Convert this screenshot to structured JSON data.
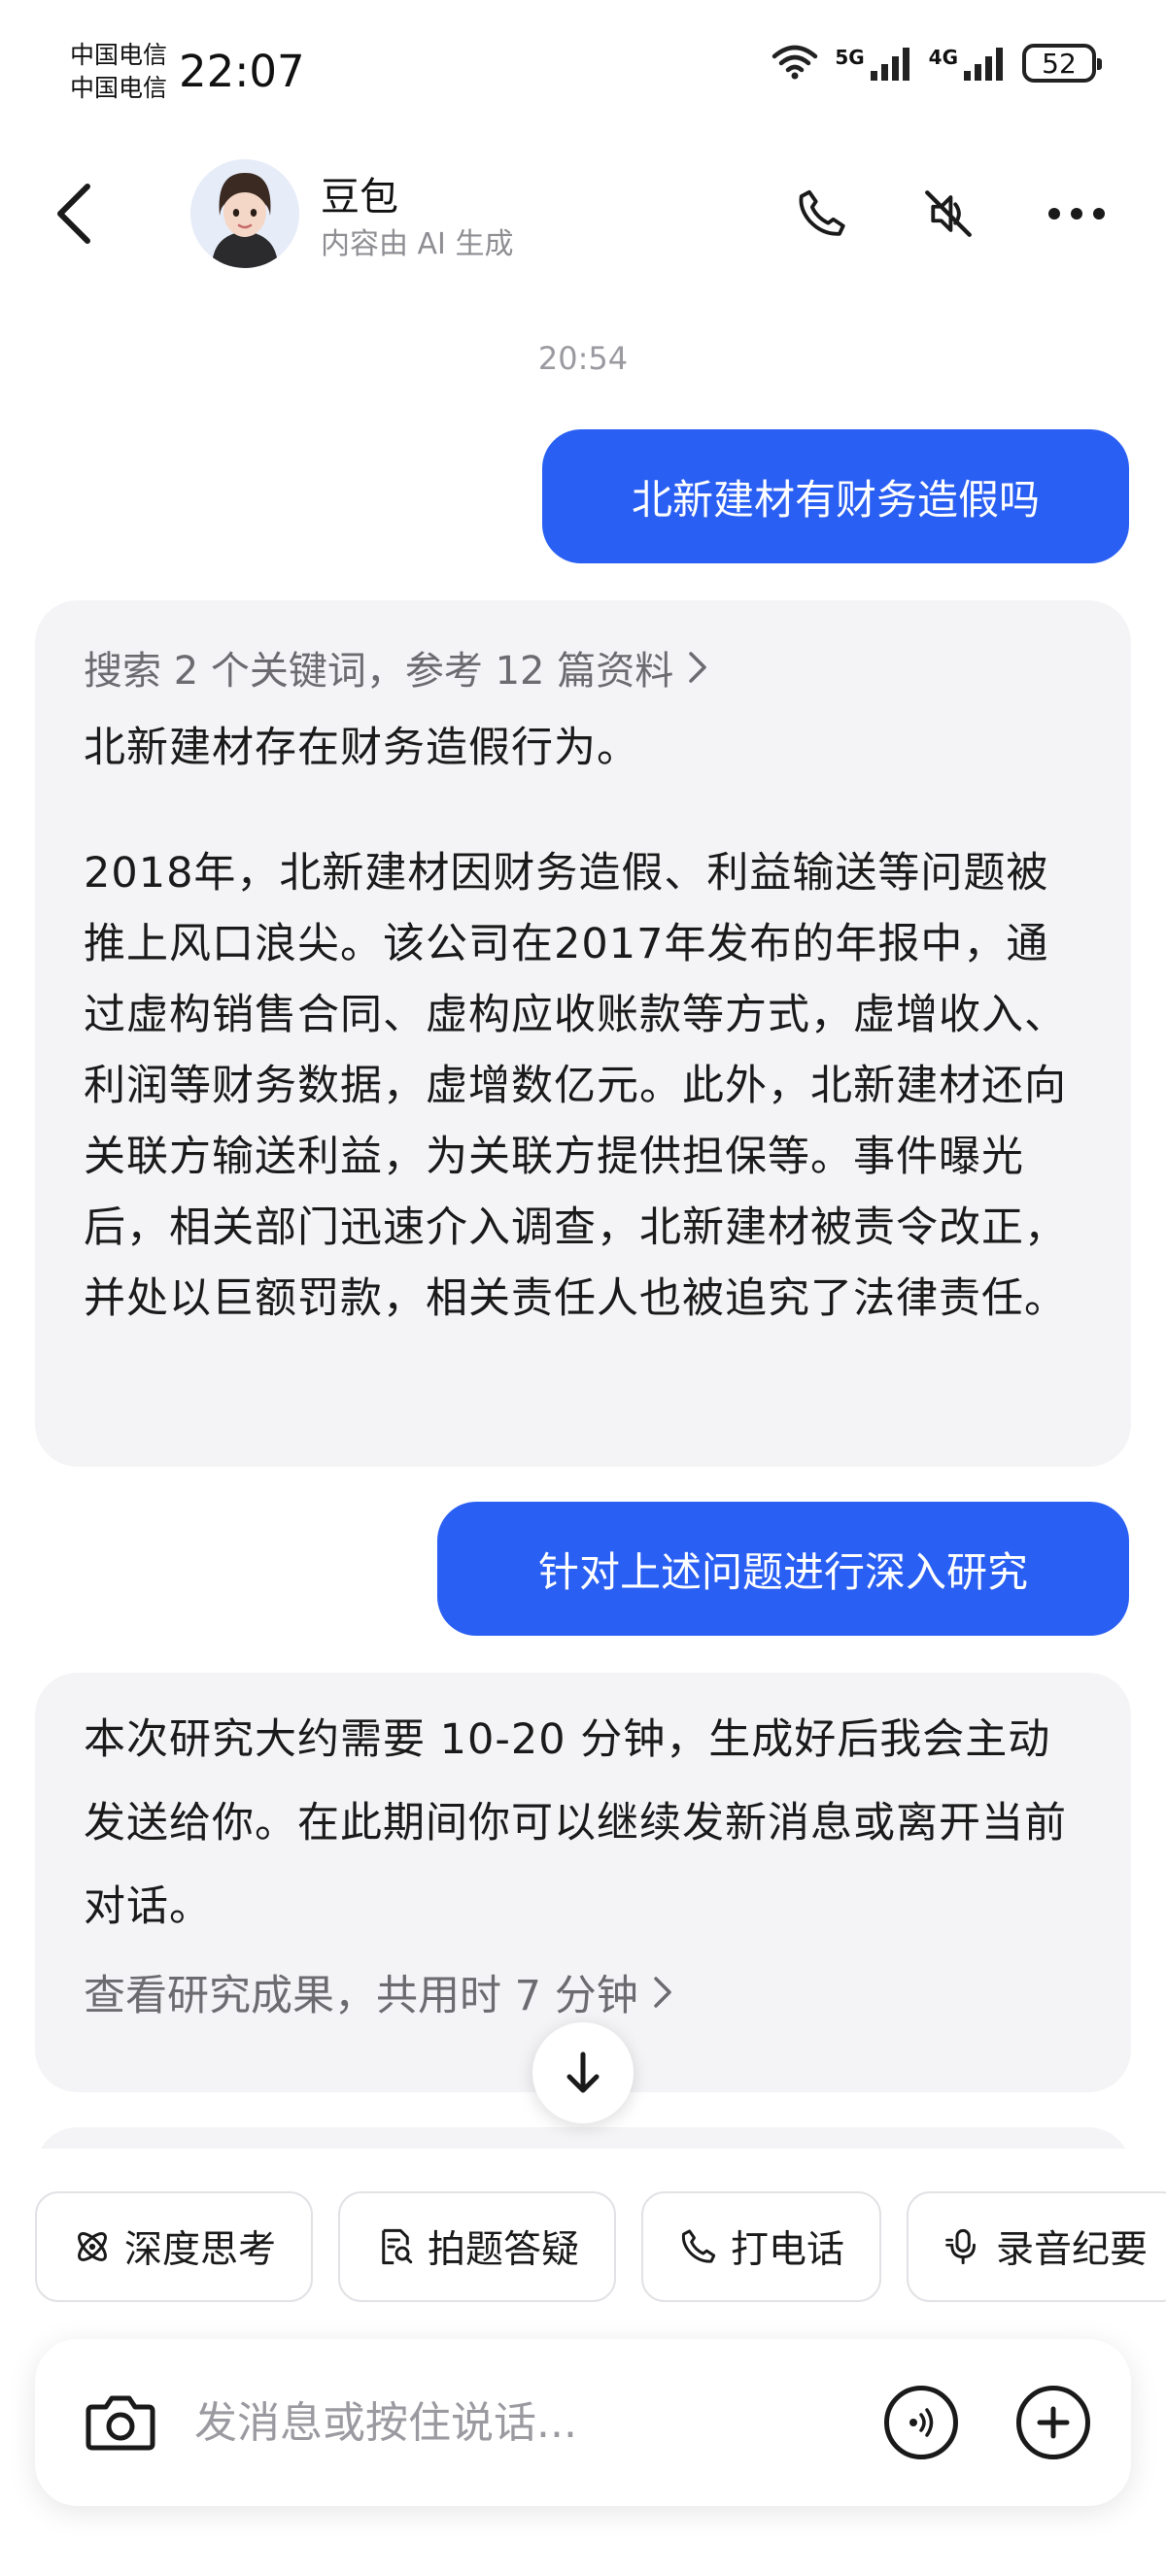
{
  "status_bar": {
    "carrier_1": "中国电信",
    "carrier_2": "中国电信",
    "time": "22:07",
    "net_1": "5G",
    "net_2": "4G",
    "battery": "52"
  },
  "header": {
    "name": "豆包",
    "subtitle": "内容由 AI 生成"
  },
  "chat": {
    "timestamp": "20:54",
    "messages": [
      {
        "role": "user",
        "text": "北新建材有财务造假吗"
      },
      {
        "role": "bot",
        "reference": "搜索 2 个关键词，参考 12 篇资料",
        "summary": "北新建材存在财务造假行为。",
        "body": "2018年，北新建材因财务造假、利益输送等问题被推上风口浪尖。该公司在2017年发布的年报中，通过虚构销售合同、虚构应收账款等方式，虚增收入、利润等财务数据，虚增数亿元。此外，北新建材还向关联方输送利益，为关联方提供担保等。事件曝光后，相关部门迅速介入调查，北新建材被责令改正，并处以巨额罚款，相关责任人也被追究了法律责任。"
      },
      {
        "role": "user",
        "text": "针对上述问题进行深入研究"
      },
      {
        "role": "bot",
        "body": "本次研究大约需要 10-20 分钟，生成好后我会主动发送给你。在此期间你可以继续发新消息或离开当前对话。",
        "link": "查看研究成果，共用时 7 分钟"
      }
    ]
  },
  "quick_actions": [
    {
      "label": "深度思考",
      "icon": "atom-icon"
    },
    {
      "label": "拍题答疑",
      "icon": "document-search-icon"
    },
    {
      "label": "打电话",
      "icon": "phone-icon"
    },
    {
      "label": "录音纪要",
      "icon": "microphone-icon"
    }
  ],
  "input": {
    "placeholder": "发消息或按住说话..."
  },
  "colors": {
    "user_bubble": "#2a5ff3",
    "bot_bubble": "#f4f4f6",
    "muted_text": "#6b6b70"
  }
}
